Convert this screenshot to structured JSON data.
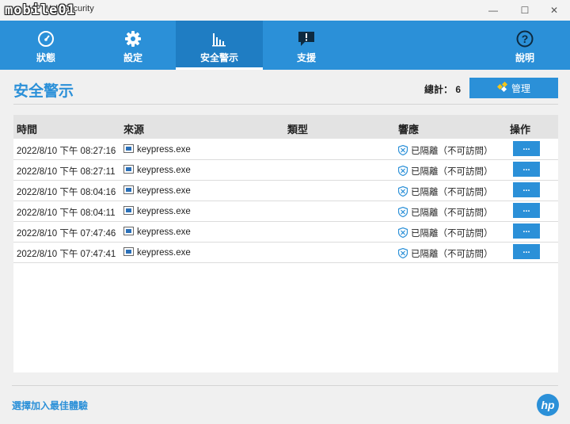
{
  "window": {
    "logo_text": "mobile01",
    "app_title": "HP Wolf Security",
    "minimize": "—",
    "maximize": "☐",
    "close": "✕"
  },
  "nav": {
    "items": [
      {
        "label": "狀態",
        "icon": "gauge-icon"
      },
      {
        "label": "設定",
        "icon": "gear-icon"
      },
      {
        "label": "安全警示",
        "icon": "bar-chart-icon",
        "active": true
      },
      {
        "label": "支援",
        "icon": "chat-alert-icon"
      },
      {
        "label": "說明",
        "icon": "help-icon"
      }
    ]
  },
  "main": {
    "title": "安全警示",
    "total_label": "總計：",
    "total_count": "6",
    "manage_label": "管理",
    "table": {
      "headers": [
        "時間",
        "來源",
        "類型",
        "響應",
        "操作"
      ],
      "rows": [
        {
          "time": "2022/8/10 下午 08:27:16",
          "source": "keypress.exe",
          "type": "",
          "response": "已隔離（不可訪問）",
          "action": "..."
        },
        {
          "time": "2022/8/10 下午 08:27:11",
          "source": "keypress.exe",
          "type": "",
          "response": "已隔離（不可訪問）",
          "action": "..."
        },
        {
          "time": "2022/8/10 下午 08:04:16",
          "source": "keypress.exe",
          "type": "",
          "response": "已隔離（不可訪問）",
          "action": "..."
        },
        {
          "time": "2022/8/10 下午 08:04:11",
          "source": "keypress.exe",
          "type": "",
          "response": "已隔離（不可訪問）",
          "action": "..."
        },
        {
          "time": "2022/8/10 下午 07:47:46",
          "source": "keypress.exe",
          "type": "",
          "response": "已隔離（不可訪問）",
          "action": "..."
        },
        {
          "time": "2022/8/10 下午 07:47:41",
          "source": "keypress.exe",
          "type": "",
          "response": "已隔離（不可訪問）",
          "action": "..."
        }
      ]
    }
  },
  "footer": {
    "link": "選擇加入最佳體驗",
    "logo": "hp"
  },
  "colors": {
    "accent": "#2b90d8",
    "nav_active": "#1f7dc3"
  }
}
